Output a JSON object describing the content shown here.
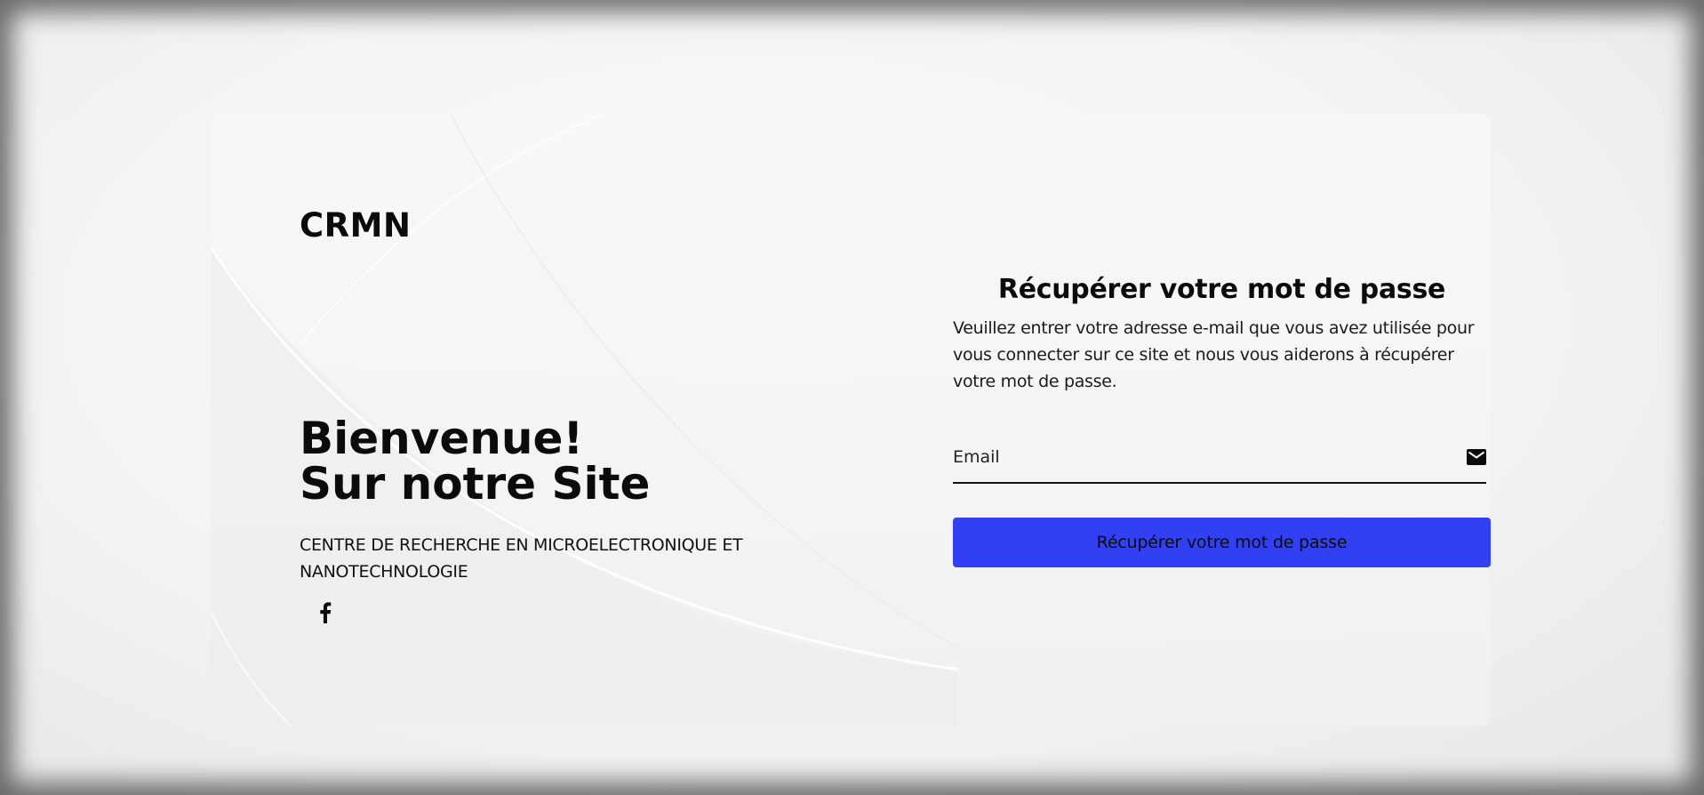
{
  "brand": {
    "name": "CRMN"
  },
  "welcome": {
    "line1": "Bienvenue!",
    "line2": "Sur notre Site"
  },
  "subtitle": "CENTRE DE RECHERCHE EN MICROELECTRONIQUE ET NANOTECHNOLOGIE",
  "social": {
    "icon": "facebook-icon"
  },
  "form": {
    "title": "Récupérer votre mot de passe",
    "description": "Veuillez entrer votre adresse e-mail que vous avez utilisée pour vous connecter sur ce site et nous vous aiderons à récupérer votre mot de passe.",
    "email_placeholder": "Email",
    "email_icon": "mail-icon",
    "submit_label": "Récupérer votre mot de passe"
  },
  "colors": {
    "accent": "#3140f2",
    "text": "#0b0b0b",
    "background": "#f5f5f5"
  }
}
